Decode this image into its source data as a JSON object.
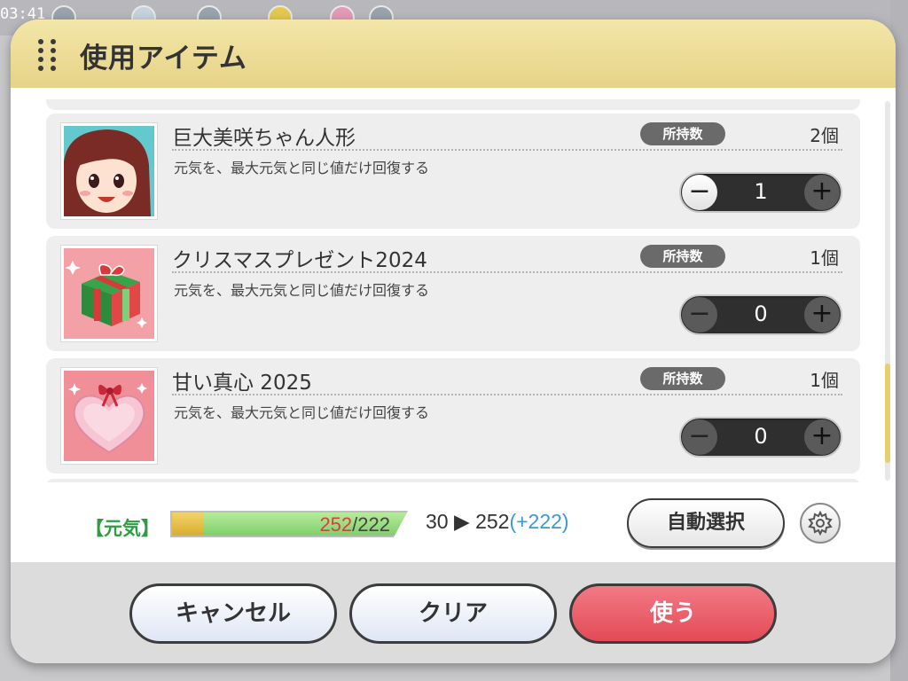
{
  "background": {
    "clock": "03:41"
  },
  "modal": {
    "title": "使用アイテム"
  },
  "items": [
    {
      "name": "巨大美咲ちゃん人形",
      "description": "元気を、最大元気と同じ値だけ回復する",
      "owned_label": "所持数",
      "owned_count": "2個",
      "quantity": "1",
      "minus_enabled": true,
      "icon": "doll-icon"
    },
    {
      "name": "クリスマスプレゼント2024",
      "description": "元気を、最大元気と同じ値だけ回復する",
      "owned_label": "所持数",
      "owned_count": "1個",
      "quantity": "0",
      "minus_enabled": false,
      "icon": "gift-box-icon"
    },
    {
      "name": "甘い真心 2025",
      "description": "元気を、最大元気と同じ値だけ回復する",
      "owned_label": "所持数",
      "owned_count": "1個",
      "quantity": "0",
      "minus_enabled": false,
      "icon": "heart-chocolate-box-icon"
    }
  ],
  "stepper": {
    "minus": "−",
    "plus": "+"
  },
  "stamina": {
    "label": "【元気】",
    "current": "252",
    "separator": "/",
    "max": "222",
    "before": "30",
    "arrow": "▶",
    "after": "252",
    "gain": "(+222)",
    "before_fraction": 0.135,
    "after_fraction": 1.0
  },
  "buttons": {
    "auto_select": "自動選択",
    "cancel": "キャンセル",
    "clear": "クリア",
    "use": "使う"
  },
  "colors": {
    "header": "#e6d387",
    "use_button": "#e44a55",
    "stamina_label": "#2e9c42",
    "gain": "#3a9ad9"
  }
}
